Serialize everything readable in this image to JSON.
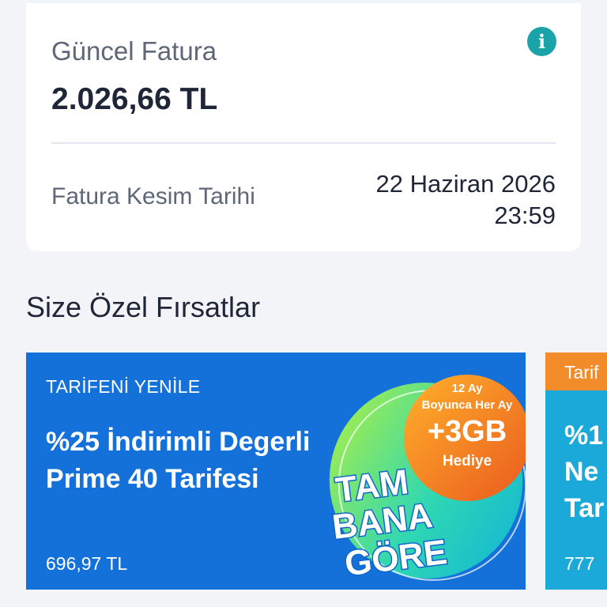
{
  "bill": {
    "title": "Güncel Fatura",
    "amount": "2.026,66 TL",
    "cut_label": "Fatura Kesim Tarihi",
    "cut_date": "22 Haziran 2026",
    "cut_time": "23:59",
    "info_glyph": "i"
  },
  "offers_section": {
    "title": "Size Özel Fırsatlar"
  },
  "offers": [
    {
      "eyebrow": "TARİFENİ YENİLE",
      "headline": "%25 İndirimli Degerli Prime 40 Tarifesi",
      "price": "696,97 TL",
      "promo": {
        "line1": "12 Ay",
        "line2": "Boyunca Her Ay",
        "big": "+3GB",
        "gift": "Hediye",
        "word1": "TAM",
        "word2": "BANA",
        "word3": "GÖRE"
      }
    },
    {
      "eyebrow": "Tarif",
      "headline_1": "%1",
      "headline_2": "Ne",
      "headline_3": "Tar",
      "price": "777"
    }
  ],
  "colors": {
    "page_bg": "#f2f4f8",
    "card_bg": "#ffffff",
    "accent_teal": "#1aa3a8",
    "offer_blue": "#1471da",
    "offer_orange": "#f28b2a"
  }
}
